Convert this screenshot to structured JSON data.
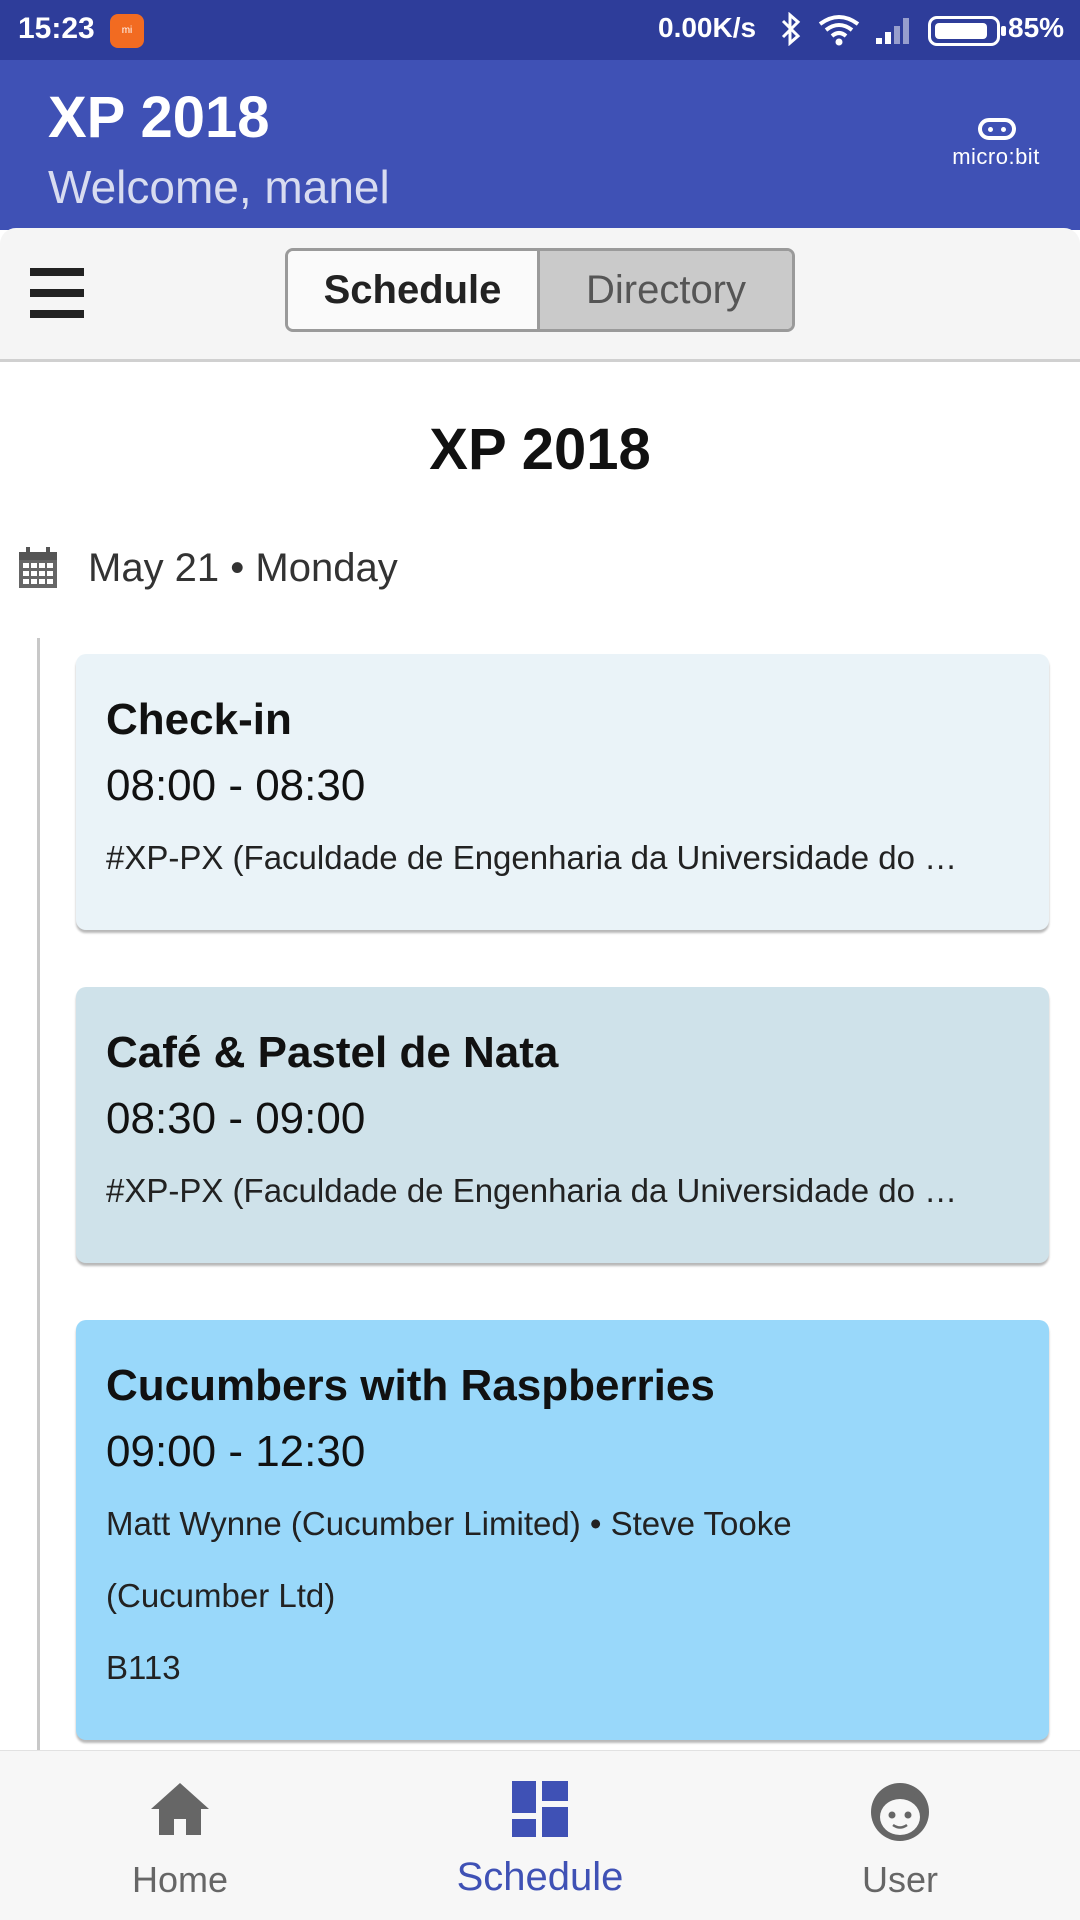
{
  "status_bar": {
    "time": "15:23",
    "notification_icon": "mi-icon",
    "net_speed": "0.00K/s",
    "battery_percent": "85%",
    "icons": [
      "bluetooth-icon",
      "wifi-icon",
      "signal-icon",
      "battery-icon"
    ]
  },
  "header": {
    "title": "XP 2018",
    "subtitle": "Welcome, manel",
    "logo_text": "micro:bit",
    "background_color": "#3f51b5"
  },
  "toolbar": {
    "menu_icon": "hamburger-menu-icon",
    "tabs": [
      {
        "label": "Schedule",
        "active": true
      },
      {
        "label": "Directory",
        "active": false
      }
    ]
  },
  "main": {
    "heading": "XP 2018",
    "date_icon": "calendar-icon",
    "date": "May 21 • Monday",
    "events": [
      {
        "title": "Check-in",
        "time": "08:00 - 08:30",
        "location": "#XP-PX (Faculdade de Engenharia da Universidade do …",
        "color": "#eaf3f8"
      },
      {
        "title": "Café & Pastel de Nata",
        "time": "08:30 - 09:00",
        "location": "#XP-PX (Faculdade de Engenharia da Universidade do …",
        "color": "#cfe2ea"
      },
      {
        "title": "Cucumbers with Raspberries",
        "time": "09:00 - 12:30",
        "speakers": "Matt Wynne (Cucumber Limited) • Steve Tooke (Cucumber Ltd)",
        "room": "B113",
        "color": "#99d8fa"
      }
    ]
  },
  "bottom_nav": {
    "items": [
      {
        "label": "Home",
        "icon": "home-icon",
        "active": false
      },
      {
        "label": "Schedule",
        "icon": "schedule-icon",
        "active": true
      },
      {
        "label": "User",
        "icon": "user-icon",
        "active": false
      }
    ],
    "active_color": "#3f51b5"
  }
}
